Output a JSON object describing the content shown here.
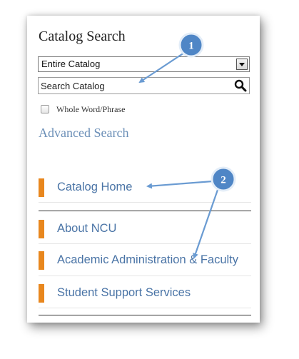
{
  "catalog_search": {
    "title": "Catalog Search",
    "scope_select": {
      "selected": "Entire Catalog"
    },
    "search_input": {
      "placeholder": "Search Catalog"
    },
    "whole_word_label": "Whole Word/Phrase",
    "whole_word_checked": false,
    "advanced_search_label": "Advanced Search"
  },
  "nav": {
    "items": [
      {
        "label": "Catalog Home"
      },
      {
        "label": "About NCU"
      },
      {
        "label": "Academic Administration & Faculty"
      },
      {
        "label": "Student Support Services"
      }
    ]
  },
  "annotations": {
    "callouts": [
      {
        "number": "1"
      },
      {
        "number": "2"
      }
    ]
  },
  "colors": {
    "link_blue": "#4a74a6",
    "advanced_link": "#6b8fb7",
    "accent_orange": "#e8871e",
    "callout_fill": "#4f86c6",
    "callout_border": "#e3edf8",
    "arrow": "#6a9bd2"
  },
  "icons": {
    "search": "magnifier-icon",
    "dropdown": "chevron-down-icon"
  }
}
